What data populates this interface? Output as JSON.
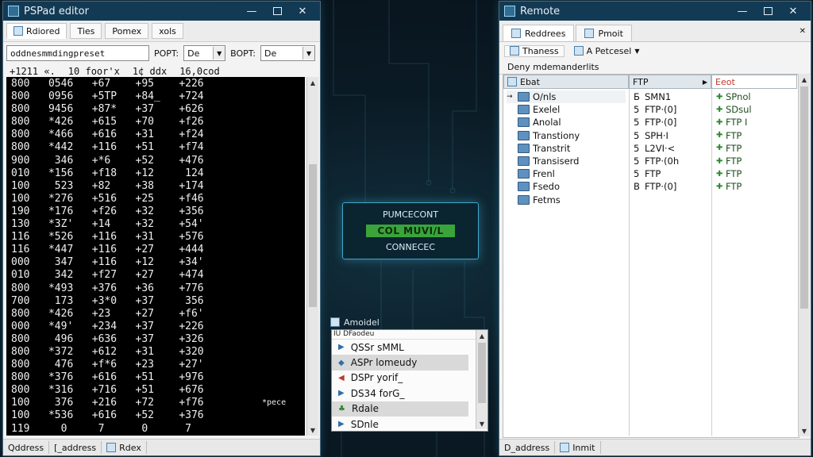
{
  "left_window": {
    "title": "PSPad editor",
    "tabs": [
      {
        "label": "Rdiored",
        "icon": "document-icon"
      },
      {
        "label": "Ties"
      },
      {
        "label": "Pomex"
      },
      {
        "label": "xols"
      }
    ],
    "address_value": "oddnesmmdingpreset",
    "port1_label": "POPT:",
    "port1_value": "De",
    "port2_label": "BOPT:",
    "port2_value": "De",
    "info_row": [
      "+1211 «.",
      "10 foor'x",
      "1¢ ddx",
      "16,0cod"
    ],
    "terminal_lines": [
      "800   0546   +67    +95    +226",
      "800   0956   +5TP   +84_   +724",
      "800   9456   +87*   +37    +626",
      "800   *426   +615   +70    +f26",
      "800   *466   +616   +31    +f24",
      "800   *442   +116   +51    +f74",
      "900    346   +*6    +52    +476",
      "010   *156   +f18   +12     124",
      "100    523   +82    +38    +174",
      "100   *276   +516   +25    +f46",
      "190   *176   +f26   +32    +356",
      "130   *3Z'   +14    +32    +54'",
      "116   *526   +116   +31    +576",
      "116   *447   +116   +27    +444",
      "000    347   +116   +12    +34'",
      "010    342   +f27   +27    +474",
      "800   *493   +376   +36    +776",
      "700    173   +3*0   +37     356",
      "800   *426   +23    +27    +f6'",
      "000   *49'   +234   +37    +226",
      "800    496   +636   +37    +326",
      "800   *372   +612   +31    +320",
      "800    476   +f*6   +23    +27'",
      "800   *376   +616   +51    +976",
      "800   *316   +716   +51    +676",
      "100    376   +216   +72    +f76",
      "100   *536   +616   +52    +376",
      "119     0     7      0      7"
    ],
    "scroll_marker": "*pece",
    "status": {
      "seg1": "Qddress",
      "seg2": "[_address",
      "seg3": "Rdex"
    }
  },
  "connection_panel": {
    "heading": "PUMCECONT",
    "status": "COL MUVI/L",
    "button": "CONNECEC",
    "status_color": "#3aa43a"
  },
  "session_list": {
    "title": "Amoidel",
    "header": "IU DFaodeu",
    "items": [
      {
        "label": "QSSr sMML",
        "icon": "play-icon",
        "selected": false
      },
      {
        "label": "ASPr lomeudy",
        "icon": "shield-icon",
        "selected": true
      },
      {
        "label": "DSPr yorif_",
        "icon": "back-arrow-icon",
        "selected": false
      },
      {
        "label": "DS34 forG_",
        "icon": "play-icon",
        "selected": false
      },
      {
        "label": "Rdale",
        "icon": "leaf-icon",
        "selected": true
      },
      {
        "label": "SDnle",
        "icon": "play-icon",
        "selected": false
      }
    ]
  },
  "right_window": {
    "title": "Remote",
    "tabs": [
      {
        "label": "Reddrees",
        "icon": "network-icon"
      },
      {
        "label": "Pmoit",
        "icon": "document-icon"
      }
    ],
    "toolbar": {
      "btn1": "Thaness",
      "btn2": "A Petcesel"
    },
    "path_label": "Deny mdemanderlits",
    "columns": [
      "Ebat",
      "FTP",
      "Eeot"
    ],
    "rows": [
      {
        "name": "O/nls",
        "c2": "SMN1",
        "c3": "SPnol",
        "n1": "Б",
        "expander": "→"
      },
      {
        "name": "Exelel",
        "c2": "FTP·(0]",
        "c3": "SDsul",
        "n1": "5",
        "expander": ""
      },
      {
        "name": "Anolal",
        "c2": "FTP·(0]",
        "c3": "FTP I",
        "n1": "5",
        "expander": ""
      },
      {
        "name": "Transtiony",
        "c2": "SPH·I",
        "c3": "FTP",
        "n1": "5",
        "expander": ""
      },
      {
        "name": "Transtrit",
        "c2": "L2VI·<",
        "c3": "FTP",
        "n1": "5",
        "expander": ""
      },
      {
        "name": "Transiserd",
        "c2": "FTP·(0h",
        "c3": "FTP",
        "n1": "5",
        "expander": ""
      },
      {
        "name": "Frenl",
        "c2": "FTP",
        "c3": "FTP",
        "n1": "5",
        "expander": ""
      },
      {
        "name": "Fsedo",
        "c2": "FTP·(0]",
        "c3": "FTP",
        "n1": "В",
        "expander": ""
      },
      {
        "name": "Fetms",
        "c2": "",
        "c3": "",
        "n1": "",
        "expander": ""
      }
    ],
    "status": {
      "seg1": "D_address",
      "seg2": "Inmit"
    }
  }
}
